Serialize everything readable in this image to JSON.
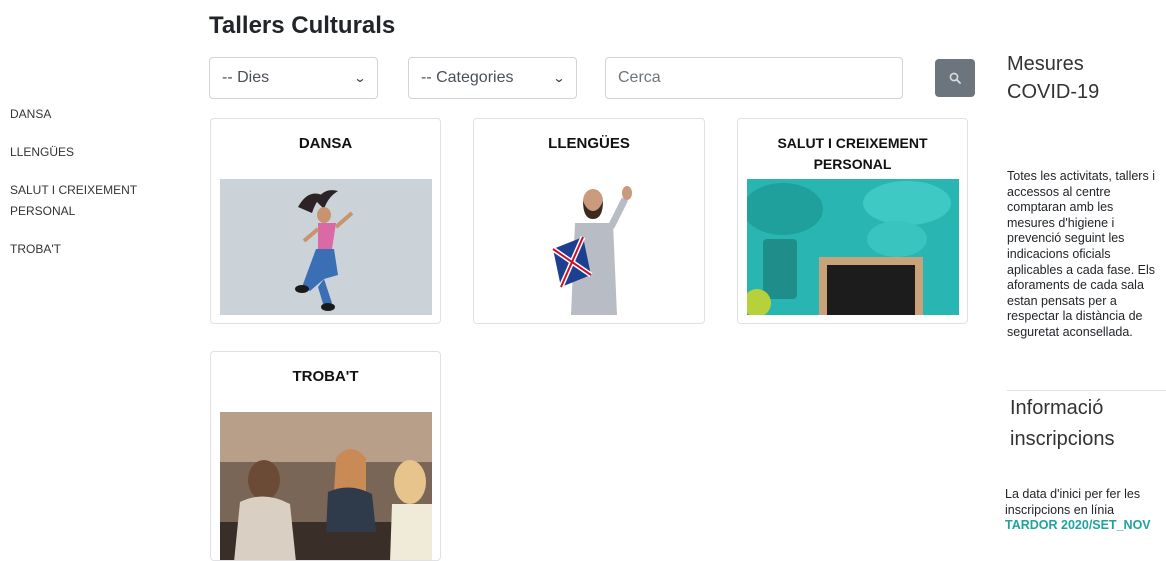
{
  "page_title": "Tallers Culturals",
  "sidebar": {
    "items": [
      {
        "label": "DANSA"
      },
      {
        "label": "LLENGÜES"
      },
      {
        "label": "SALUT I CREIXEMENT PERSONAL"
      },
      {
        "label": "TROBA'T"
      }
    ]
  },
  "filters": {
    "days_selected": "-- Dies",
    "categories_selected": "-- Categories",
    "search_placeholder": "Cerca"
  },
  "cards": [
    {
      "title": "DANSA"
    },
    {
      "title": "LLENGÜES"
    },
    {
      "title": "SALUT I CREIXEMENT PERSONAL"
    },
    {
      "title": "TROBA'T"
    }
  ],
  "covid": {
    "heading": "Mesures COVID-19",
    "text": "Totes les activitats, tallers i accessos al centre comptaran amb les mesures d'higiene i prevenció seguint les indicacions oficials aplicables a cada fase. Els aforaments de cada sala estan pensats per a respectar la distància de seguretat aconsellada."
  },
  "info": {
    "heading": "Informació inscripcions",
    "text": "La data d'inici per fer les inscripcions en línia",
    "highlight": "TARDOR 2020/SET_NOV"
  },
  "colors": {
    "accent": "#20a39e",
    "button": "#6c757d"
  }
}
